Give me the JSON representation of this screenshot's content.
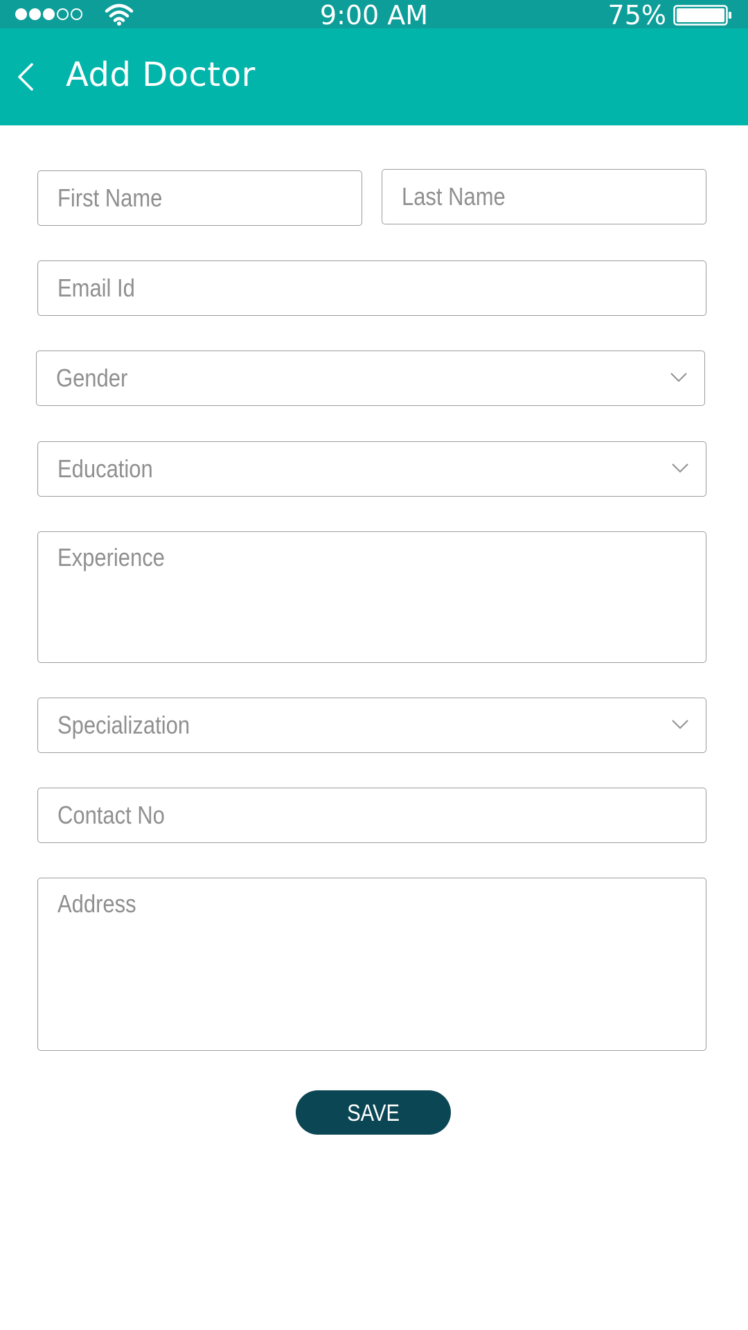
{
  "status_bar": {
    "time": "9:00 AM",
    "battery_percent": "75%",
    "signal_strength": 3,
    "signal_max": 5
  },
  "header": {
    "title": "Add Doctor",
    "background": "#02b5aa"
  },
  "form": {
    "first_name_placeholder": "First Name",
    "last_name_placeholder": "Last Name",
    "email_placeholder": "Email Id",
    "gender_placeholder": "Gender",
    "education_placeholder": "Education",
    "experience_placeholder": "Experience",
    "specialization_placeholder": "Specialization",
    "contact_placeholder": "Contact No",
    "address_placeholder": "Address"
  },
  "actions": {
    "save_label": "SAVE",
    "save_color": "#0b4654"
  }
}
